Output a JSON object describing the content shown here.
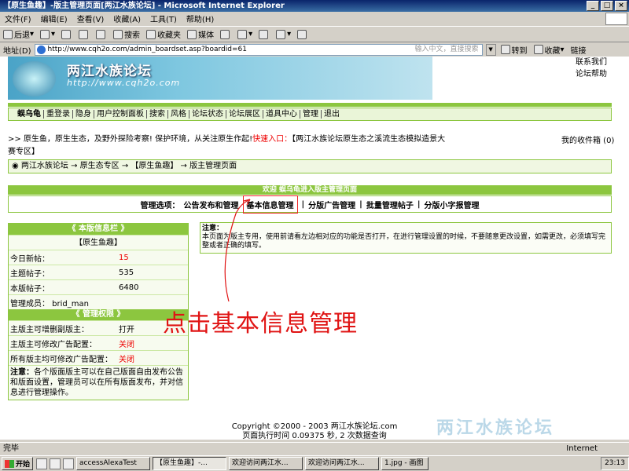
{
  "window": {
    "title": "【原生鱼趣】-版主管理页面[两江水族论坛] - Microsoft Internet Explorer"
  },
  "menu": [
    "文件(F)",
    "编辑(E)",
    "查看(V)",
    "收藏(A)",
    "工具(T)",
    "帮助(H)"
  ],
  "toolbar": {
    "back": "后退",
    "search": "搜索",
    "favorites": "收藏夹",
    "media": "媒体"
  },
  "address": {
    "label": "地址(D)",
    "url": "http://www.cqh2o.com/admin_boardset.asp?boardid=61",
    "hint": "输入中文，直接搜索",
    "go": "转到",
    "fav": "收藏",
    "links": "链接"
  },
  "site": {
    "logo": "两江水族论坛",
    "logo_url": "http://www.cqh2o.com",
    "top_links": [
      "联系我们",
      "论坛帮助"
    ]
  },
  "nav": [
    "蜈乌龟",
    "重登录",
    "隐身",
    "用户控制面板",
    "搜索",
    "风格",
    "论坛状态",
    "论坛展区",
    "道具中心",
    "管理",
    "退出"
  ],
  "notice": {
    "prefix": ">> 原生鱼，原生生态，及野外探险考察! 保护环境，从关注原生作起!",
    "red": "快速入口：",
    "rest": "【两江水族论坛原生态之溪流生态模拟造景大赛专区】",
    "inbox": "我的收件箱 (0)"
  },
  "breadcrumb": "两江水族论坛 → 原生态专区 → 【原生鱼趣】 → 版主管理页面",
  "welcome": "欢迎 蜈乌龟进入版主管理页面",
  "options": {
    "label": "管理选项：",
    "items": [
      "公告发布和管理",
      "基本信息管理",
      "分版广告管理",
      "批量管理帖子",
      "分版小字报管理"
    ]
  },
  "board_info": {
    "title": "《 本版信息栏 》",
    "board_name": "【原生鱼趣】",
    "rows": [
      {
        "k": "今日新帖：",
        "v": "15"
      },
      {
        "k": "主题帖子：",
        "v": "535"
      },
      {
        "k": "本版帖子：",
        "v": "6480"
      }
    ],
    "members": "管理成员： brid_man"
  },
  "perm": {
    "title": "《 管理权限 》",
    "rows": [
      {
        "k": "主版主可增删副版主：",
        "v": "打开"
      },
      {
        "k": "主版主可修改广告配置：",
        "v": "关闭"
      },
      {
        "k": "所有版主均可修改广告配置：",
        "v": "关闭"
      }
    ],
    "note_label": "注意：",
    "note": "各个版面版主可以在自己版面自由发布公告和版面设置，管理员可以在所有版面发布，并对信息进行管理操作。"
  },
  "notebox": {
    "label": "注意：",
    "text": "本页面为版主专用，使用前请看左边相对应的功能是否打开，在进行管理设置的时候，不要随意更改设置，如需更改，必须填写完整或者正确的填写。"
  },
  "annotation": "点击基本信息管理",
  "footer": {
    "copyright": "Copyright ©2000 - 2003 两江水族论坛.com",
    "exec": "页面执行时间 0.09375 秒, 2 次数据查询"
  },
  "status": {
    "text": "完毕",
    "zone": "Internet"
  },
  "taskbar": {
    "start": "开始",
    "tasks": [
      "accessAlexaTest",
      "【原生鱼趣】-...",
      "欢迎访问两江水...",
      "欢迎访问两江水...",
      "1.jpg - 画图"
    ],
    "clock": "23:13"
  }
}
